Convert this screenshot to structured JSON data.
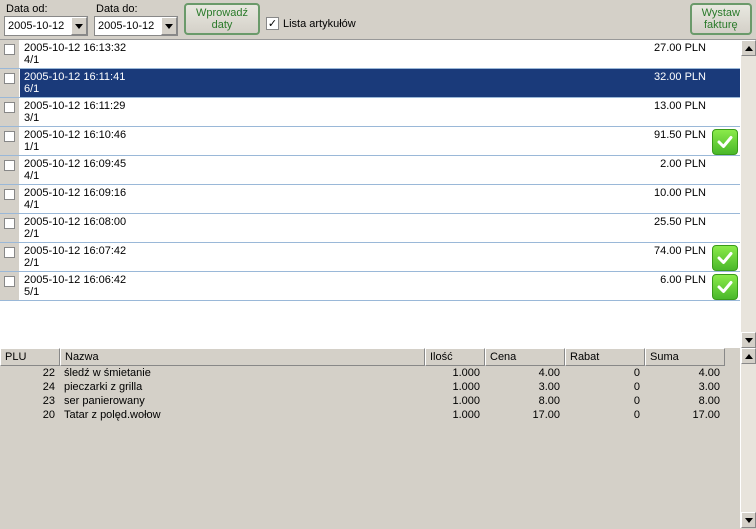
{
  "toolbar": {
    "date_from_label": "Data od:",
    "date_from_value": "2005-10-12",
    "date_to_label": "Data do:",
    "date_to_value": "2005-10-12",
    "enter_dates_btn": "Wprowadź daty",
    "article_list_label": "Lista artykułów",
    "article_list_checked": "✓",
    "invoice_btn": "Wystaw fakturę"
  },
  "rows": [
    {
      "date": "2005-10-12 16:13:32",
      "sub": "4/1",
      "price": "27.00 PLN",
      "selected": false,
      "ok": false
    },
    {
      "date": "2005-10-12 16:11:41",
      "sub": "6/1",
      "price": "32.00 PLN",
      "selected": true,
      "ok": false
    },
    {
      "date": "2005-10-12 16:11:29",
      "sub": "3/1",
      "price": "13.00 PLN",
      "selected": false,
      "ok": false
    },
    {
      "date": "2005-10-12 16:10:46",
      "sub": "1/1",
      "price": "91.50 PLN",
      "selected": false,
      "ok": true
    },
    {
      "date": "2005-10-12 16:09:45",
      "sub": "4/1",
      "price": "2.00 PLN",
      "selected": false,
      "ok": false
    },
    {
      "date": "2005-10-12 16:09:16",
      "sub": "4/1",
      "price": "10.00 PLN",
      "selected": false,
      "ok": false
    },
    {
      "date": "2005-10-12 16:08:00",
      "sub": "2/1",
      "price": "25.50 PLN",
      "selected": false,
      "ok": false
    },
    {
      "date": "2005-10-12 16:07:42",
      "sub": "2/1",
      "price": "74.00 PLN",
      "selected": false,
      "ok": true
    },
    {
      "date": "2005-10-12 16:06:42",
      "sub": "5/1",
      "price": "6.00 PLN",
      "selected": false,
      "ok": true
    }
  ],
  "grid": {
    "headers": {
      "plu": "PLU",
      "name": "Nazwa",
      "qty": "Ilość",
      "price": "Cena",
      "rabat": "Rabat",
      "sum": "Suma"
    },
    "items": [
      {
        "plu": "22",
        "name": "śledź w śmietanie",
        "qty": "1.000",
        "price": "4.00",
        "rabat": "0",
        "sum": "4.00"
      },
      {
        "plu": "24",
        "name": "pieczarki z grilla",
        "qty": "1.000",
        "price": "3.00",
        "rabat": "0",
        "sum": "3.00"
      },
      {
        "plu": "23",
        "name": "ser panierowany",
        "qty": "1.000",
        "price": "8.00",
        "rabat": "0",
        "sum": "8.00"
      },
      {
        "plu": "20",
        "name": "Tatar z polęd.wołow",
        "qty": "1.000",
        "price": "17.00",
        "rabat": "0",
        "sum": "17.00"
      }
    ]
  }
}
